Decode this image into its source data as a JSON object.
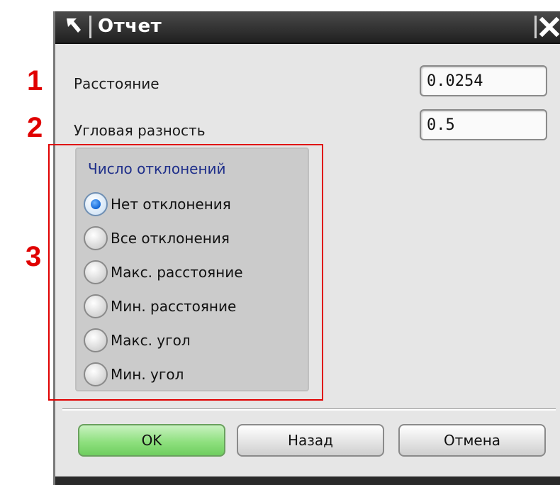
{
  "window": {
    "title": "Отчет",
    "close_icon": "close-icon",
    "pin_icon": "arrow-pin-icon"
  },
  "fields": {
    "distance": {
      "label": "Расстояние",
      "value": "0.0254"
    },
    "angular": {
      "label": "Угловая разность",
      "value": "0.5"
    }
  },
  "deviations": {
    "title": "Число отклонений",
    "options": [
      {
        "label": "Нет отклонения",
        "selected": true
      },
      {
        "label": "Все отклонения",
        "selected": false
      },
      {
        "label": "Макс. расстояние",
        "selected": false
      },
      {
        "label": "Мин. расстояние",
        "selected": false
      },
      {
        "label": "Макс. угол",
        "selected": false
      },
      {
        "label": "Мин. угол",
        "selected": false
      }
    ]
  },
  "buttons": {
    "ok": "OK",
    "back": "Назад",
    "cancel": "Отмена"
  },
  "annotations": [
    "1",
    "2",
    "3"
  ],
  "colors": {
    "annotation": "#e00000",
    "ok_button": "#8fe07f",
    "selected_radio": "#1166d6",
    "group_title": "#1f2f8a"
  }
}
